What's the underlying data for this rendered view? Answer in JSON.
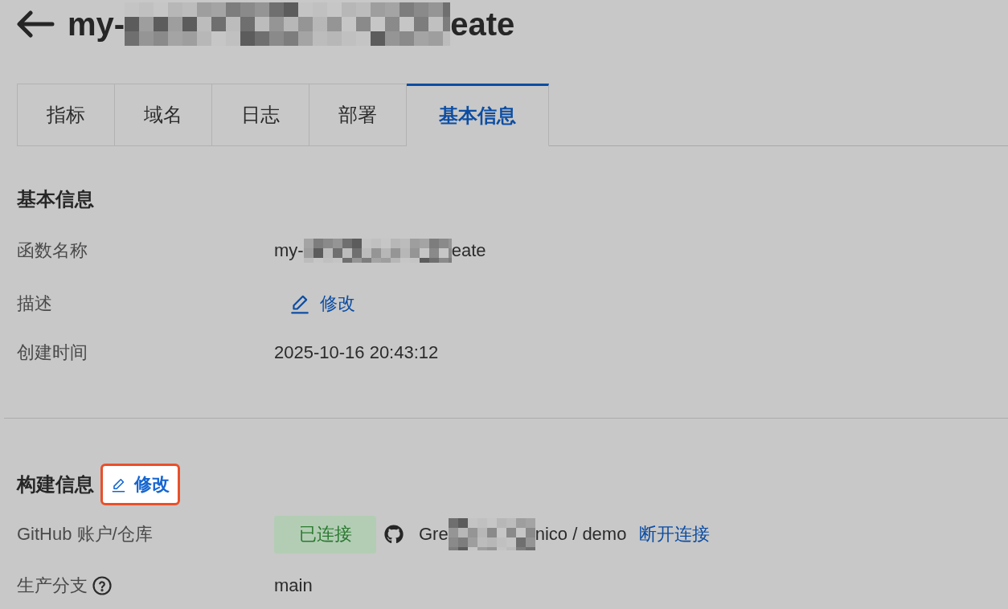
{
  "header": {
    "title_before": "my-",
    "redacted": true,
    "title_after": "eate"
  },
  "tabs": [
    {
      "label": "指标",
      "selected": false
    },
    {
      "label": "域名",
      "selected": false
    },
    {
      "label": "日志",
      "selected": false
    },
    {
      "label": "部署",
      "selected": false
    },
    {
      "label": "基本信息",
      "selected": true
    }
  ],
  "basic_info": {
    "heading": "基本信息",
    "rows": [
      {
        "kind": "redacted_text",
        "label": "函数名称",
        "value_before": "my-",
        "value_after": "eate"
      },
      {
        "kind": "edit_link",
        "label": "描述",
        "link": "修改"
      },
      {
        "kind": "text",
        "label": "创建时间",
        "value": "2025-10-16 20:43:12"
      }
    ]
  },
  "build_info": {
    "heading": "构建信息",
    "edit": {
      "label": "修改",
      "highlighted": true
    },
    "rows": [
      {
        "kind": "repo",
        "label": "GitHub 账户/仓库",
        "status": "已连接",
        "account_before": "Gre",
        "account_after": "nico / demo",
        "action": "断开连接"
      },
      {
        "kind": "text",
        "label": "生产分支",
        "help": true,
        "value": "main"
      }
    ]
  }
}
